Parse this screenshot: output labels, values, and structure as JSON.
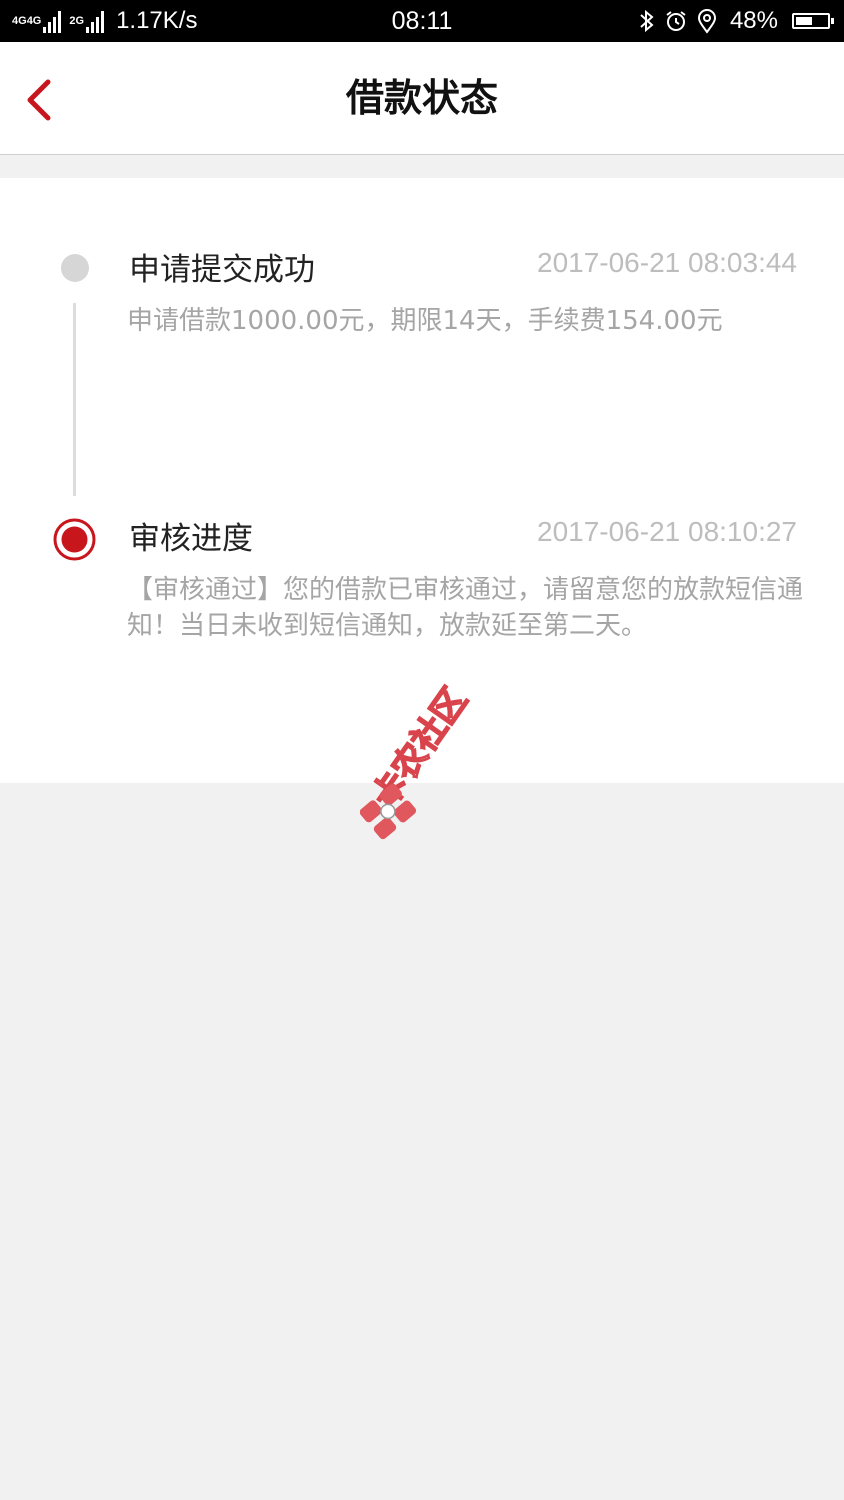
{
  "status_bar": {
    "net_label_1": "4G",
    "net_label_2": "4G",
    "net_label_3": "2G",
    "speed": "1.17K/s",
    "time": "08:11",
    "battery": "48%",
    "battery_level": 0.48
  },
  "header": {
    "title": "借款状态",
    "accent_color": "#c8161d"
  },
  "timeline": [
    {
      "title": "申请提交成功",
      "time": "2017-06-21 08:03:44",
      "description": "申请借款1000.00元，期限14天，手续费154.00元"
    },
    {
      "title": "审核进度",
      "time": "2017-06-21 08:10:27",
      "description": "【审核通过】您的借款已审核通过，请留意您的放款短信通知！当日未收到短信通知，放款延至第二天。"
    }
  ],
  "watermark": {
    "text": "卡农社区"
  }
}
